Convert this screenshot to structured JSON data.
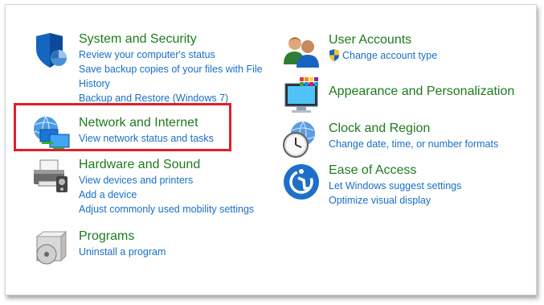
{
  "left": {
    "system": {
      "title": "System and Security",
      "links": [
        "Review your computer's status",
        "Save backup copies of your files with File History",
        "Backup and Restore (Windows 7)"
      ],
      "icon": "shield-icon"
    },
    "network": {
      "title": "Network and Internet",
      "links": [
        "View network status and tasks"
      ],
      "icon": "network-globe-icon"
    },
    "hardware": {
      "title": "Hardware and Sound",
      "links": [
        "View devices and printers",
        "Add a device",
        "Adjust commonly used mobility settings"
      ],
      "icon": "printer-icon"
    },
    "programs": {
      "title": "Programs",
      "links": [
        "Uninstall a program"
      ],
      "icon": "programs-icon"
    }
  },
  "right": {
    "users": {
      "title": "User Accounts",
      "links": [
        "Change account type"
      ],
      "icon": "users-icon"
    },
    "appearance": {
      "title": "Appearance and Personalization",
      "links": [],
      "icon": "appearance-icon"
    },
    "clock": {
      "title": "Clock and Region",
      "links": [
        "Change date, time, or number formats"
      ],
      "icon": "clock-globe-icon"
    },
    "ease": {
      "title": "Ease of Access",
      "links": [
        "Let Windows suggest settings",
        "Optimize visual display"
      ],
      "icon": "ease-of-access-icon"
    }
  },
  "colors": {
    "title_green": "#1e7a1e",
    "link_blue": "#1a6fc4",
    "highlight_red": "#e0202a"
  }
}
